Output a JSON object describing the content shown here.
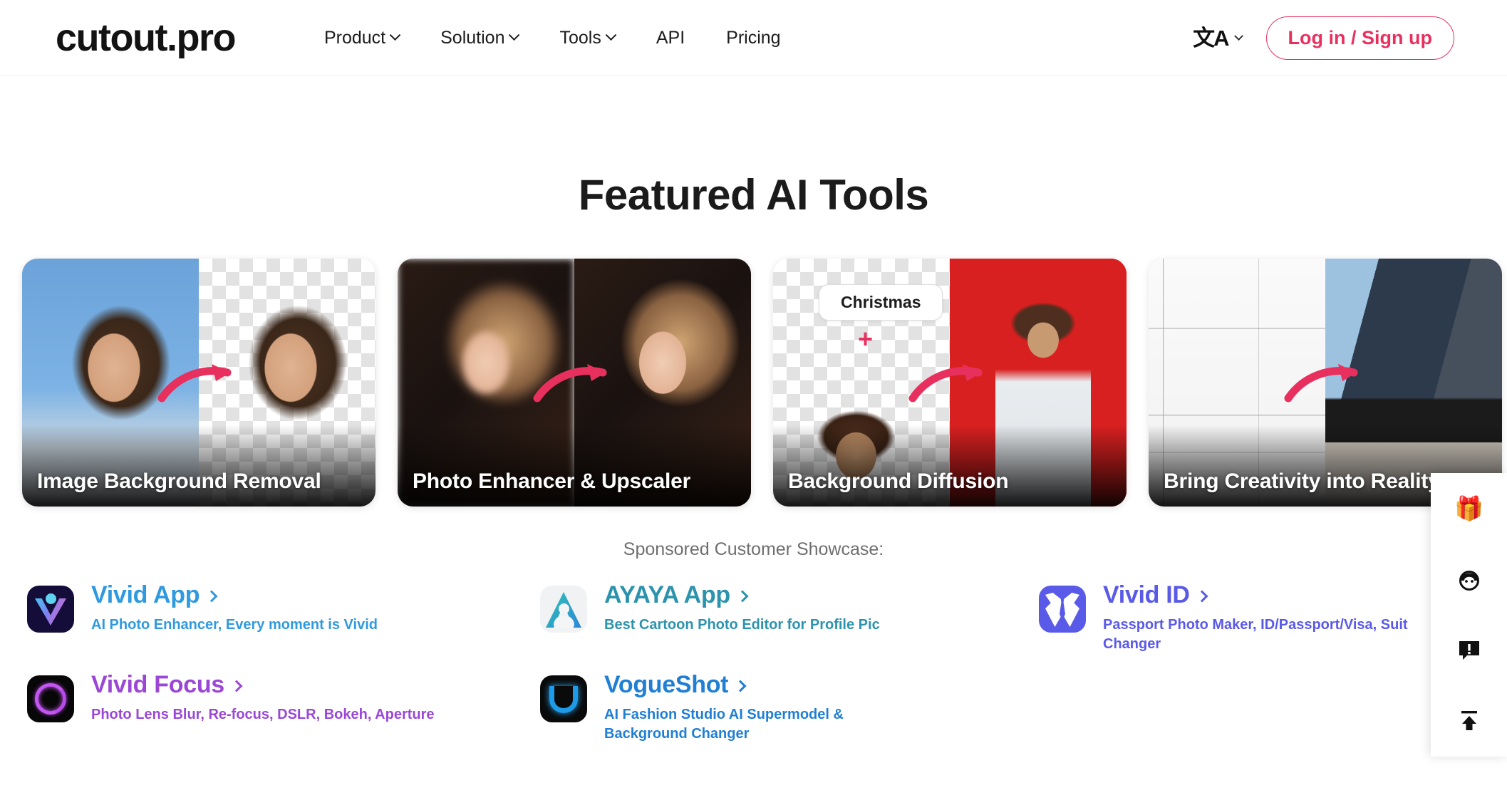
{
  "header": {
    "logo": "cutout.pro",
    "nav": [
      {
        "label": "Product",
        "has_dropdown": true
      },
      {
        "label": "Solution",
        "has_dropdown": true
      },
      {
        "label": "Tools",
        "has_dropdown": true
      },
      {
        "label": "API",
        "has_dropdown": false
      },
      {
        "label": "Pricing",
        "has_dropdown": false
      }
    ],
    "language_glyph": "文A",
    "login_label": "Log in / Sign up",
    "accent_color": "#e8305f"
  },
  "main": {
    "title": "Featured AI Tools",
    "cards": [
      {
        "caption": "Image Background Removal"
      },
      {
        "caption": "Photo Enhancer & Upscaler"
      },
      {
        "caption": "Background Diffusion",
        "pill": "Christmas",
        "plus": "+"
      },
      {
        "caption": "Bring Creativity into Reality"
      }
    ]
  },
  "showcase": {
    "heading": "Sponsored Customer Showcase:",
    "items": [
      {
        "name": "Vivid App",
        "tagline": "AI Photo Enhancer, Every moment is Vivid",
        "color": "#2f9ae0"
      },
      {
        "name": "AYAYA App",
        "tagline": "Best Cartoon Photo Editor for Profile Pic",
        "color": "#2b93ad"
      },
      {
        "name": "Vivid ID",
        "tagline": "Passport Photo Maker, ID/Passport/Visa, Suit Changer",
        "color": "#5a5ae8"
      },
      {
        "name": "Vivid Focus",
        "tagline": "Photo Lens Blur, Re-focus, DSLR, Bokeh, Aperture",
        "color": "#9b47d6"
      },
      {
        "name": "VogueShot",
        "tagline": "AI Fashion Studio AI Supermodel & Background Changer",
        "color": "#1f7fd4"
      }
    ]
  },
  "float_panel": {
    "buttons": [
      {
        "icon": "gift-icon",
        "glyph": "🎁"
      },
      {
        "icon": "customer-support-icon",
        "glyph": ""
      },
      {
        "icon": "feedback-icon",
        "glyph": ""
      },
      {
        "icon": "scroll-to-top-icon",
        "glyph": ""
      }
    ]
  }
}
